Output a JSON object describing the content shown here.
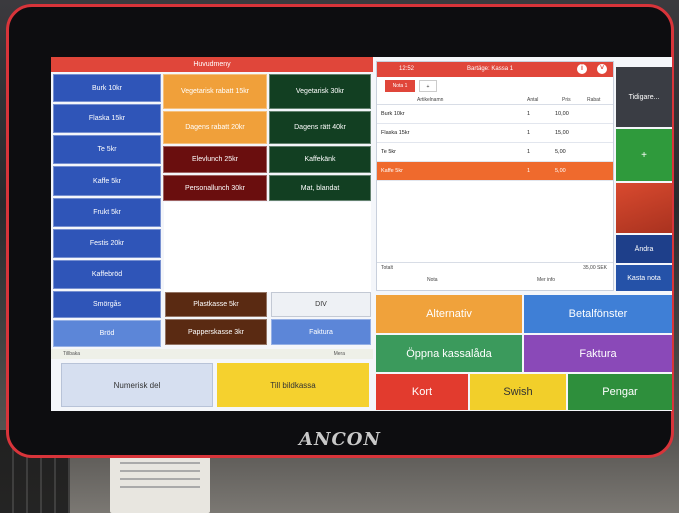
{
  "menu_title": "Huvudmeny",
  "brand": "ANCON",
  "menu": {
    "col1": [
      "Burk 10kr",
      "Flaska 15kr",
      "Te 5kr",
      "Kaffe 5kr",
      "Frukt 5kr",
      "Festis 20kr",
      "Kaffebröd",
      "Smörgås",
      "Bröd"
    ],
    "col2": [
      "Vegetarisk rabatt 15kr",
      "Dagens rabatt 20kr",
      "Elevlunch 25kr",
      "Personallunch 30kr"
    ],
    "col3": [
      "Vegetarisk 30kr",
      "Dagens rätt 40kr",
      "Kaffekänk",
      "Mat, blandat"
    ],
    "bags": [
      "Plastkasse 5kr",
      "Papperskasse 3kr"
    ],
    "div_label": "DIV",
    "faktura_small": "Faktura"
  },
  "back_label": "Tillbaka",
  "next_label": "Mera",
  "numerisk_label": "Numerisk del",
  "bildkassa_label": "Till bildkassa",
  "receipt": {
    "time": "12:52",
    "title": "Bartäge: Kassa 1",
    "tabs": [
      "Nota 1",
      "+"
    ],
    "columns": [
      "Artikelnamn",
      "Antal",
      "Pris",
      "Rabat"
    ],
    "rows": [
      {
        "name": "Burk 10kr",
        "qty": "1",
        "price": "10,00"
      },
      {
        "name": "Flaska 15kr",
        "qty": "1",
        "price": "15,00"
      },
      {
        "name": "Te 5kr",
        "qty": "1",
        "price": "5,00"
      },
      {
        "name": "Kaffe 5kr",
        "qty": "1",
        "price": "5,00"
      }
    ],
    "total_label": "Totalt",
    "total_value": "35,00 SEK",
    "nota_label": "Nota",
    "mer_label": "Mer info"
  },
  "side": {
    "tidigare": "Tidigare...",
    "plus": "+",
    "andra": "Ändra",
    "kasta": "Kasta nota"
  },
  "payment": {
    "alternativ": "Alternativ",
    "betalfonster": "Betalfönster",
    "oppna": "Öppna kassalåda",
    "faktura": "Faktura",
    "kort": "Kort",
    "swish": "Swish",
    "pengar": "Pengar"
  }
}
